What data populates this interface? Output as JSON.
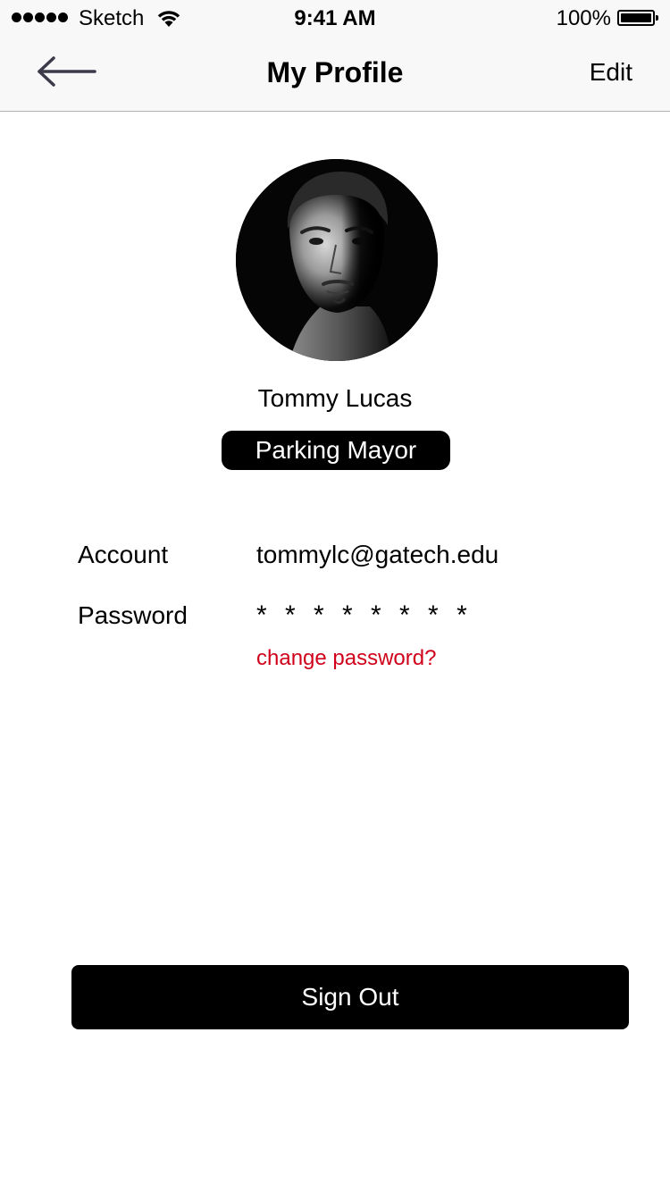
{
  "status_bar": {
    "carrier": "Sketch",
    "time": "9:41 AM",
    "battery_percent": "100%",
    "battery_level": 1.0,
    "signal_icon": "signal-dots-icon",
    "wifi_icon": "wifi-icon",
    "battery_icon": "battery-icon"
  },
  "nav": {
    "title": "My Profile",
    "edit_label": "Edit",
    "back_icon": "back-arrow-icon"
  },
  "profile": {
    "name": "Tommy Lucas",
    "role_badge": "Parking Mayor",
    "avatar_icon": "avatar-photo"
  },
  "account": {
    "account_label": "Account",
    "account_value": "tommylc@gatech.edu",
    "password_label": "Password",
    "password_value": "* * * * * * * *",
    "change_password_label": "change password?"
  },
  "sign_out": {
    "label": "Sign Out"
  },
  "colors": {
    "accent_red": "#d0021b",
    "bar_background": "#f8f8f8",
    "button_background": "#000000",
    "button_text": "#ffffff"
  }
}
